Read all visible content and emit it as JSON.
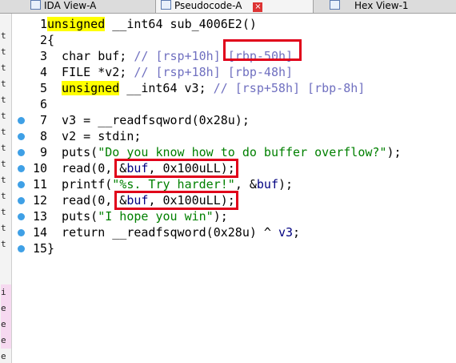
{
  "tabs": [
    {
      "label": "IDA View-A",
      "icon": "ida-view-icon",
      "active": false
    },
    {
      "label": "Pseudocode-A",
      "icon": "pseudocode-icon",
      "active": true,
      "close": "×"
    },
    {
      "label": "Hex View-1",
      "icon": "hex-view-icon",
      "active": false
    }
  ],
  "left_strip_chars": [
    "t",
    "t",
    "t",
    "t",
    "t",
    "t",
    "t",
    "t",
    "t",
    "t",
    "t",
    "t",
    "t",
    "t",
    "i",
    "e",
    "e",
    "e",
    "e",
    "e"
  ],
  "line_numbers": [
    "1",
    "2",
    "3",
    "4",
    "5",
    "6",
    "7",
    "8",
    "9",
    "10",
    "11",
    "12",
    "13",
    "14",
    "15"
  ],
  "breakpoint_lines": [
    7,
    8,
    9,
    10,
    11,
    12,
    13,
    14,
    15
  ],
  "code": {
    "l1_kw": "unsigned",
    "l1_rest": " __int64 sub_4006E2()",
    "l2": "{",
    "l3_code": "  char buf; ",
    "l3_cmt": "// [rsp+10h] [rbp-50h]",
    "l4_code": "  FILE *v2; ",
    "l4_cmt": "// [rsp+18h] [rbp-48h]",
    "l5_kw": "unsigned",
    "l5_code": " __int64 v3; ",
    "l5_cmt": "// [rsp+58h] [rbp-8h]",
    "l7": "  v3 = __readfsqword(0x28u);",
    "l8": "  v2 = stdin;",
    "l9_a": "  puts(",
    "l9_str": "\"Do you know how to do buffer overflow?\"",
    "l9_b": ");",
    "l10_a": "  read(0, &",
    "l10_var": "buf",
    "l10_b": ", 0x100uLL);",
    "l11_a": "  printf(",
    "l11_str": "\"%s. Try harder!\"",
    "l11_b": ", &",
    "l11_var": "buf",
    "l11_c": ");",
    "l12_a": "  read(0, &",
    "l12_var": "buf",
    "l12_b": ", 0x100uLL);",
    "l13_a": "  puts(",
    "l13_str": "\"I hope you win\"",
    "l13_b": ");",
    "l14_a": "  return __readfsqword(0x28u) ^ ",
    "l14_var": "v3",
    "l14_b": ";",
    "l15": "}"
  },
  "colors": {
    "highlight_box": "#e0001a",
    "keyword_bg": "#ffff00",
    "comment": "#7070c0",
    "string": "#008000",
    "breakpoint_dot": "#3fa0e6"
  }
}
